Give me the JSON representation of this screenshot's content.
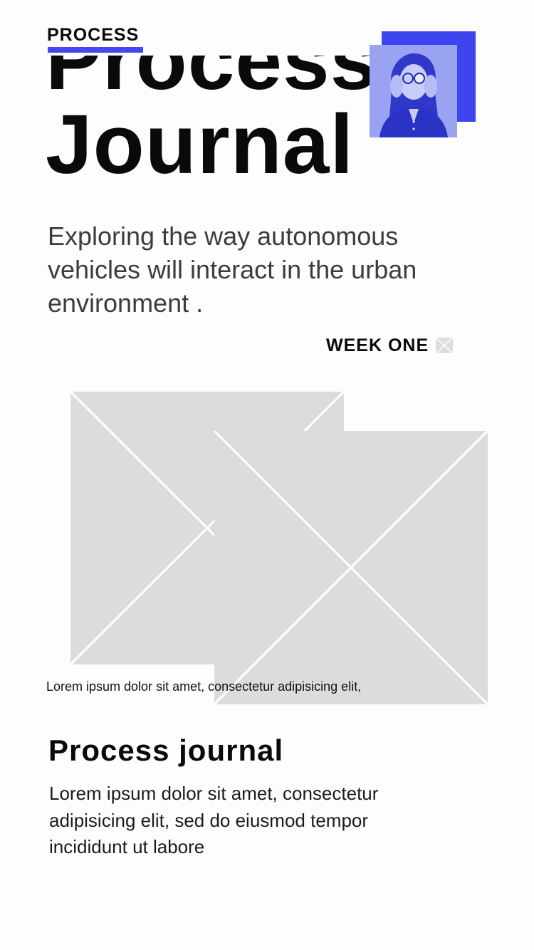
{
  "nav": {
    "label": "PROCESS",
    "accent_color": "#4249ee"
  },
  "hero": {
    "title_line1": "Process",
    "title_line2": "Journal",
    "photo_icon": "profile-photo",
    "photo_accent_color": "#3d45ee"
  },
  "intro": {
    "subtitle": "Exploring the way autonomous vehicles will interact in the urban environment ."
  },
  "week": {
    "label": "WEEK ONE",
    "icon": "image-placeholder-icon"
  },
  "gallery": {
    "placeholder_icon": "image-placeholder",
    "caption": "Lorem ipsum dolor sit amet, consectetur adipisicing elit,"
  },
  "section": {
    "title": "Process journal",
    "body": "Lorem ipsum dolor sit amet, consectetur adipisicing elit, sed do eiusmod tempor incididunt ut labore"
  }
}
